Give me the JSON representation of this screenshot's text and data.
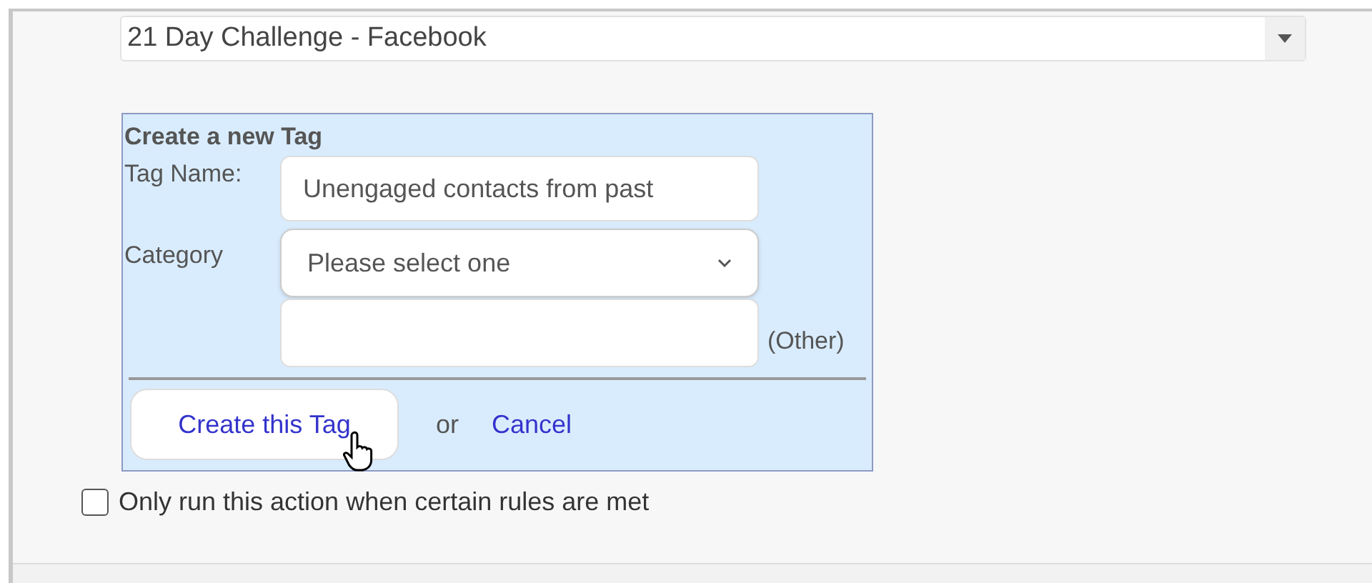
{
  "list_select": {
    "value": "21 Day Challenge - Facebook"
  },
  "tag_form": {
    "title": "Create a new Tag",
    "tag_name": {
      "label": "Tag Name:",
      "value": "Unengaged contacts from past"
    },
    "category": {
      "label": "Category",
      "value": "Please select one"
    },
    "other": {
      "suffix": "(Other)"
    },
    "create_button": "Create this Tag",
    "or_text": "or",
    "cancel_link": "Cancel"
  },
  "rules_checkbox": {
    "label": "Only run this action when certain rules are met",
    "checked": false
  }
}
